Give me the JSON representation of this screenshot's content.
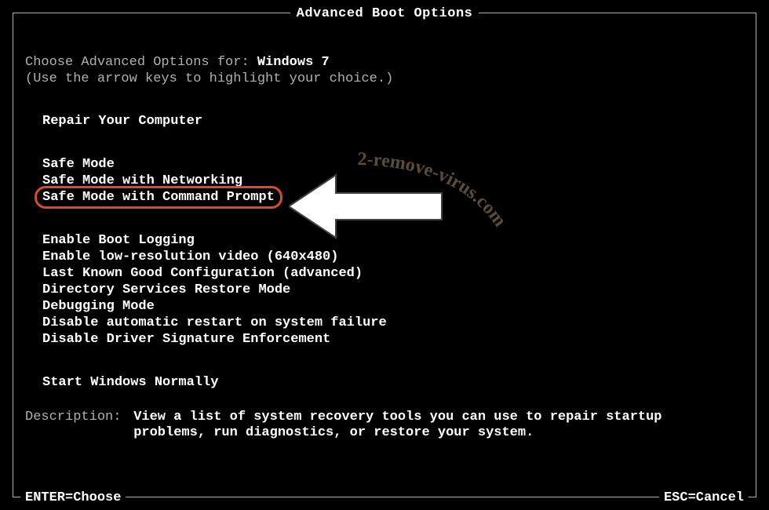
{
  "title": "Advanced Boot Options",
  "subtitle_prefix": "Choose Advanced Options for: ",
  "os_name": "Windows 7",
  "hint": "(Use the arrow keys to highlight your choice.)",
  "groups": {
    "g1": [
      "Repair Your Computer"
    ],
    "g2": [
      "Safe Mode",
      "Safe Mode with Networking",
      "Safe Mode with Command Prompt"
    ],
    "g3": [
      "Enable Boot Logging",
      "Enable low-resolution video (640x480)",
      "Last Known Good Configuration (advanced)",
      "Directory Services Restore Mode",
      "Debugging Mode",
      "Disable automatic restart on system failure",
      "Disable Driver Signature Enforcement"
    ],
    "g4": [
      "Start Windows Normally"
    ]
  },
  "highlighted_item": "Safe Mode with Command Prompt",
  "description_label": "Description:",
  "description_text": "View a list of system recovery tools you can use to repair startup problems, run diagnostics, or restore your system.",
  "footer_left": "ENTER=Choose",
  "footer_right": "ESC=Cancel",
  "watermark": "2-remove-virus.com",
  "annotation_color": "#d84a36"
}
